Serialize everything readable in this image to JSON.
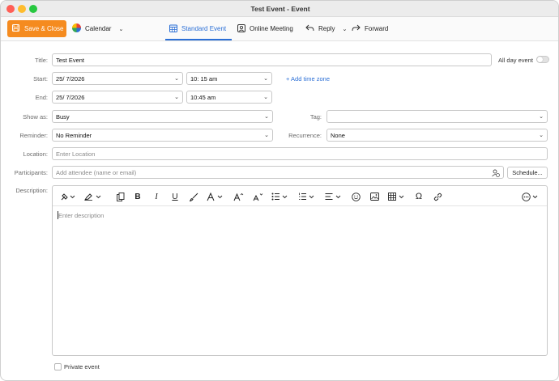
{
  "window": {
    "title": "Test Event - Event"
  },
  "ribbon": {
    "save_close": "Save & Close",
    "calendar": "Calendar",
    "tabs": [
      {
        "label": "Standard Event",
        "active": true
      },
      {
        "label": "Online Meeting"
      },
      {
        "label": "Reply"
      },
      {
        "label": "Forward"
      }
    ]
  },
  "form": {
    "title_label": "Title:",
    "title_value": "Test Event",
    "all_day_label": "All day event",
    "all_day_on": false,
    "start_label": "Start:",
    "start_date": "25/  7/2026",
    "start_time": "10: 15 am",
    "add_time_zone": "+ Add time zone",
    "end_label": "End:",
    "end_date": "25/  7/2026",
    "end_time": "10:45 am",
    "show_as_label": "Show as:",
    "show_as_value": "Busy",
    "tag_label": "Tag:",
    "tag_value": "",
    "reminder_label": "Reminder:",
    "reminder_value": "No Reminder",
    "recurrence_label": "Recurrence:",
    "recurrence_value": "None",
    "location_label": "Location:",
    "location_placeholder": "Enter Location",
    "participants_label": "Participants:",
    "participants_placeholder": "Add attendee (name or email)",
    "schedule_button": "Schedule...",
    "description_label": "Description:",
    "description_placeholder": "Enter description",
    "private_event_label": "Private event",
    "private_event_checked": false
  },
  "colors": {
    "accent": "#2b6fd6",
    "save_button": "#f58b1f",
    "close_dot": "#ff5f57",
    "minimize_dot": "#febc2e",
    "zoom_dot": "#28c840"
  },
  "toolbar_icons": [
    "format-painter-icon",
    "highlight-icon",
    "copy-icon",
    "bold-icon",
    "italic-icon",
    "underline-icon",
    "brush-icon",
    "font-color-icon",
    "font-size-up-icon",
    "font-size-down-icon",
    "bullet-list-icon",
    "numbered-list-icon",
    "align-icon",
    "emoji-icon",
    "image-icon",
    "table-icon",
    "special-char-icon",
    "link-icon",
    "more-icon"
  ]
}
